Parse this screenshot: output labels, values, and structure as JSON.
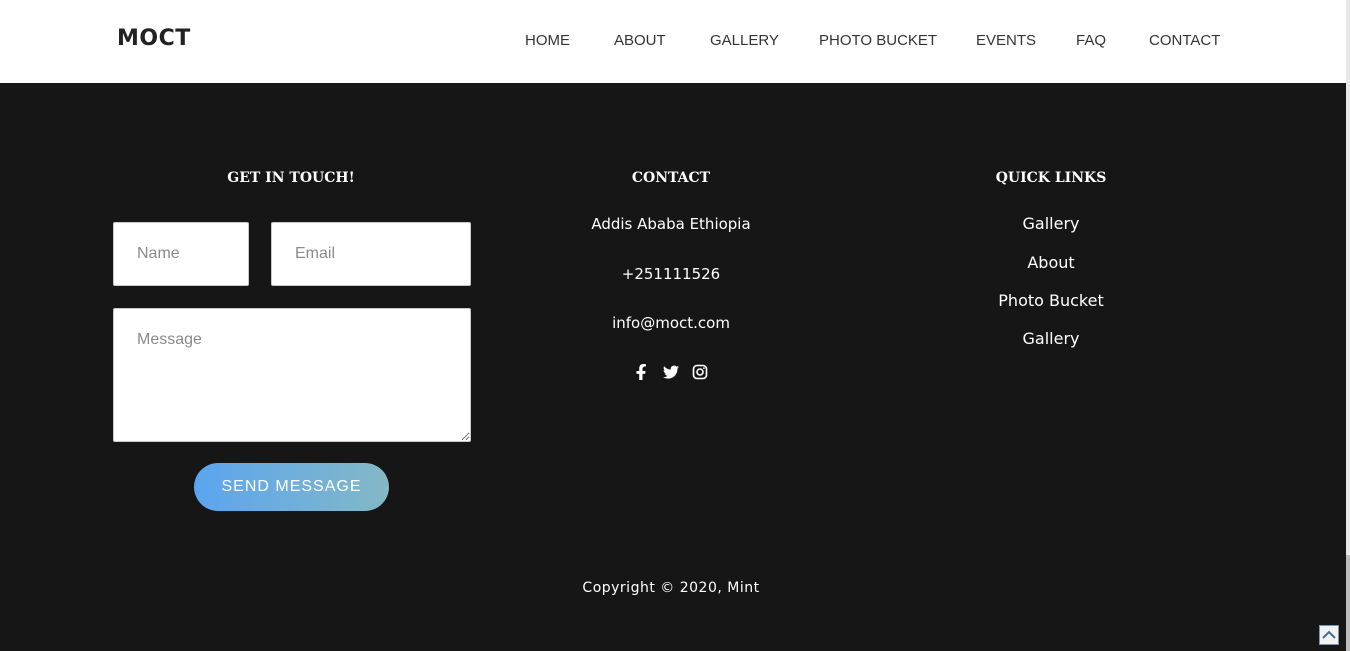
{
  "header": {
    "logo": "MOCT",
    "nav": [
      "HOME",
      "ABOUT",
      "GALLERY",
      "PHOTO BUCKET",
      "EVENTS",
      "FAQ",
      "CONTACT"
    ]
  },
  "footer": {
    "get_in_touch": {
      "heading": "GET IN TOUCH!",
      "name_placeholder": "Name",
      "email_placeholder": "Email",
      "message_placeholder": "Message",
      "send_label": "SEND MESSAGE"
    },
    "contact": {
      "heading": "CONTACT",
      "address": "Addis Ababa Ethiopia",
      "phone": "+251111526",
      "email": "info@moct.com",
      "social_icons": [
        "facebook-icon",
        "twitter-icon",
        "instagram-icon"
      ]
    },
    "quick_links": {
      "heading": "QUICK LINKS",
      "items": [
        "Gallery",
        "About",
        "Photo Bucket",
        "Gallery"
      ]
    },
    "copyright": "Copyright © 2020, Mint"
  },
  "colors": {
    "footer_bg": "#161616",
    "button_gradient_start": "#5aa5f0",
    "button_gradient_end": "#84b8c6"
  }
}
